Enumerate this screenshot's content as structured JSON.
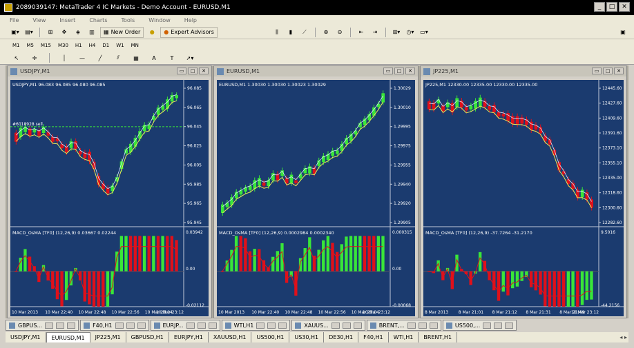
{
  "window": {
    "title": "2089039147: MetaTrader 4 IC Markets - Demo Account - EURUSD,M1",
    "minimize": "_",
    "restore": "□",
    "close": "✕"
  },
  "menu": [
    "File",
    "View",
    "Insert",
    "Charts",
    "Tools",
    "Window",
    "Help"
  ],
  "toolbar": {
    "new_order": "New Order",
    "expert_advisors": "Expert Advisors"
  },
  "timeframes": [
    "M1",
    "M5",
    "M15",
    "M30",
    "H1",
    "H4",
    "D1",
    "W1",
    "MN"
  ],
  "charts": [
    {
      "title": "USDJPY,M1",
      "header": "USDJPY,M1  96.083 96.085 96.080 96.085",
      "macd_header": "MACD_OsMA [TF0] (12,26,9)  0.03667 0.02244",
      "order_label": "#6018928 sell",
      "price_labels": [
        "96.085",
        "96.065",
        "96.045",
        "96.025",
        "96.005",
        "95.985",
        "95.965",
        "95.945"
      ],
      "macd_labels": [
        "0.03942",
        "0.00",
        "-0.02112"
      ],
      "time_labels": [
        "10 Mar 2013",
        "10 Mar 22:40",
        "10 Mar 22:48",
        "10 Mar 22:56",
        "10 Mar 23:04",
        "10 Mar 23:12"
      ]
    },
    {
      "title": "EURUSD,M1",
      "header": "EURUSD,M1  1.30030 1.30030 1.30023 1.30029",
      "macd_header": "MACD_OsMA [TF0] (12,26,9)  0.0002984 0.0002340",
      "price_labels": [
        "1.30029",
        "1.30010",
        "1.29995",
        "1.29975",
        "1.29955",
        "1.29940",
        "1.29920",
        "1.29905"
      ],
      "macd_labels": [
        "0.000315",
        "0.00",
        "-0.00068"
      ],
      "time_labels": [
        "10 Mar 2013",
        "10 Mar 22:40",
        "10 Mar 22:48",
        "10 Mar 22:56",
        "10 Mar 23:04",
        "10 Mar 23:12"
      ]
    },
    {
      "title": "JP225,M1",
      "header": "JP225,M1  12330.00 12335.00 12330.00 12335.00",
      "macd_header": "MACD_OsMA [TF0] (12,26,9)  -37.7264 -31.2170",
      "price_labels": [
        "12445.60",
        "12427.60",
        "12409.60",
        "12391.60",
        "12373.10",
        "12355.10",
        "12335.00",
        "12318.60",
        "12300.60",
        "12282.60"
      ],
      "macd_labels": [
        "9.5016",
        "-44.2156"
      ],
      "time_labels": [
        "8 Mar 2013",
        "8 Mar 21:01",
        "8 Mar 21:12",
        "8 Mar 21:31",
        "8 Mar 21:49",
        "10 Mar 23:12"
      ]
    }
  ],
  "window_tabs": [
    "GBPUS...",
    "F40,H1",
    "EURJP...",
    "WTI,H1",
    "XAUUS...",
    "BRENT,...",
    "US500,..."
  ],
  "symbol_tabs": [
    "USDJPY,M1",
    "EURUSD,M1",
    "JP225,M1",
    "GBPUSD,H1",
    "EURJPY,H1",
    "XAUUSD,H1",
    "US500,H1",
    "US30,H1",
    "DE30,H1",
    "F40,H1",
    "WTI,H1",
    "BRENT,H1"
  ],
  "active_symbol_tab": "EURUSD,M1",
  "colors": {
    "chart_bg": "#1b3b6f",
    "bull": "#39e639",
    "bear": "#e0101a",
    "ma1": "#e8e85a",
    "ma2": "#d9e8ff"
  }
}
